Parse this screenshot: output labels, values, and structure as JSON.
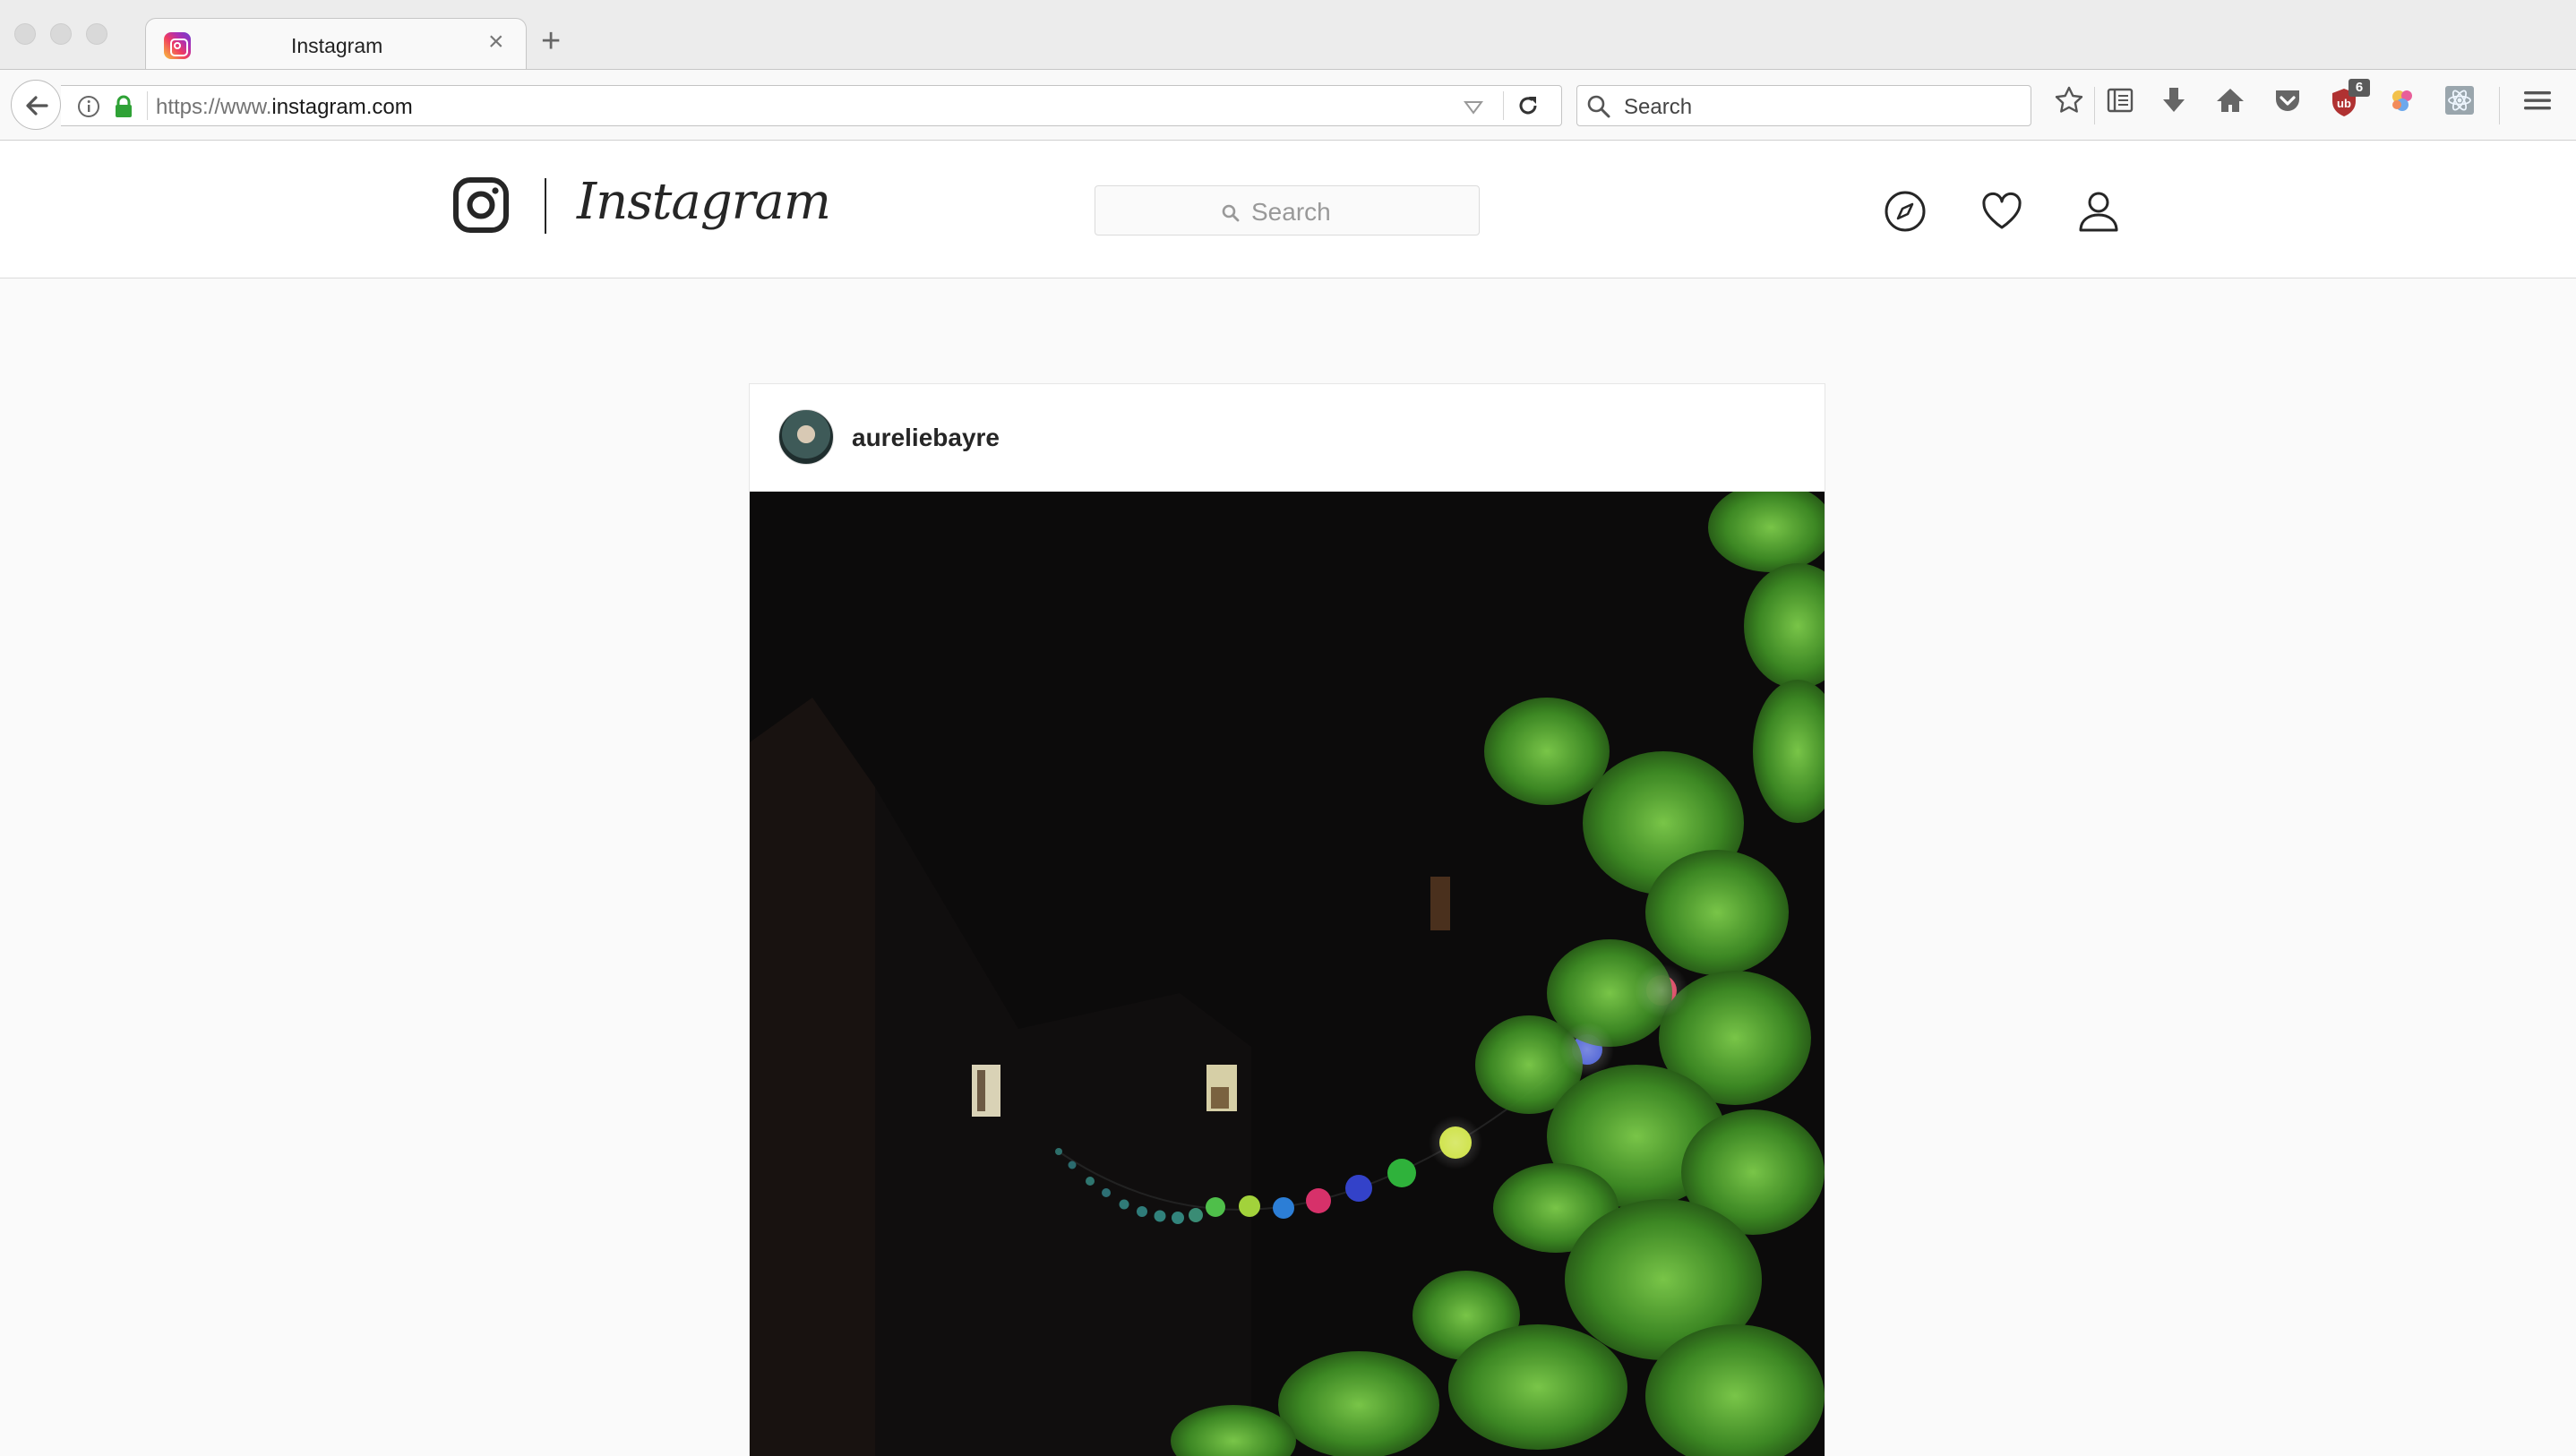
{
  "browser": {
    "tab_title": "Instagram",
    "tab_close": "×",
    "new_tab": "+",
    "url_prefix": "https://www.",
    "url_domain": "instagram.com",
    "search_placeholder": "Search",
    "extension_badge": "6"
  },
  "instagram": {
    "wordmark": "Instagram",
    "search_placeholder": "Search",
    "nav_icons": [
      "explore-icon",
      "heart-icon",
      "profile-icon"
    ]
  },
  "post": {
    "username": "aureliebayre",
    "image_description_icon": "photo"
  },
  "colors": {
    "accent": "#262626",
    "border": "#dbdbdb",
    "page_bg": "#fafafa"
  }
}
